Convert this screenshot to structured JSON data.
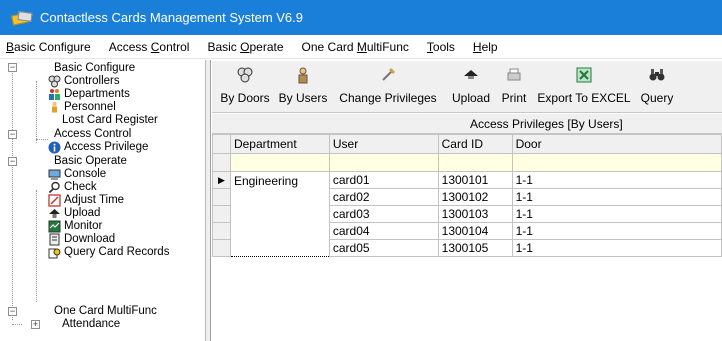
{
  "window": {
    "title": "Contactless Cards Management System  V6.9"
  },
  "menu": [
    {
      "pre": "",
      "u": "B",
      "post": "asic Configure"
    },
    {
      "pre": "Access ",
      "u": "C",
      "post": "ontrol"
    },
    {
      "pre": "Basic ",
      "u": "O",
      "post": "perate"
    },
    {
      "pre": "One Card ",
      "u": "M",
      "post": "ultiFunc"
    },
    {
      "pre": "",
      "u": "T",
      "post": "ools"
    },
    {
      "pre": "",
      "u": "H",
      "post": "elp"
    }
  ],
  "tree": {
    "basic_configure": "Basic Configure",
    "controllers": "Controllers",
    "departments": "Departments",
    "personnel": "Personnel",
    "lost_card_register": "Lost Card Register",
    "access_control": "Access Control",
    "access_privilege": "Access Privilege",
    "basic_operate": "Basic Operate",
    "console": "Console",
    "check": "Check",
    "adjust_time": "Adjust Time",
    "upload": "Upload",
    "monitor": "Monitor",
    "download": "Download",
    "query_card_records": "Query Card Records",
    "one_card_multifunc": "One Card MultiFunc",
    "attendance": "Attendance"
  },
  "toolbar": {
    "by_doors": "By Doors",
    "by_users": "By Users",
    "change_privileges": "Change Privileges",
    "upload": "Upload",
    "print": "Print",
    "export_excel": "Export To EXCEL",
    "query": "Query"
  },
  "grid": {
    "caption": "Access Privileges [By Users]",
    "columns": {
      "department": "Department",
      "user": "User",
      "card_id": "Card ID",
      "door": "Door"
    },
    "department_value": "Engineering",
    "rows": [
      {
        "user": "card01",
        "card_id": "1300101",
        "door": "1-1"
      },
      {
        "user": "card02",
        "card_id": "1300102",
        "door": "1-1"
      },
      {
        "user": "card03",
        "card_id": "1300103",
        "door": "1-1"
      },
      {
        "user": "card04",
        "card_id": "1300104",
        "door": "1-1"
      },
      {
        "user": "card05",
        "card_id": "1300105",
        "door": "1-1"
      }
    ],
    "current_row_indicator": "▶"
  },
  "tree_toggles": {
    "collapse": "−",
    "expand": "+"
  },
  "colors": {
    "titlebar": "#1a7fd9",
    "filter_row": "#ffffe1",
    "chrome": "#f0f0f0"
  }
}
